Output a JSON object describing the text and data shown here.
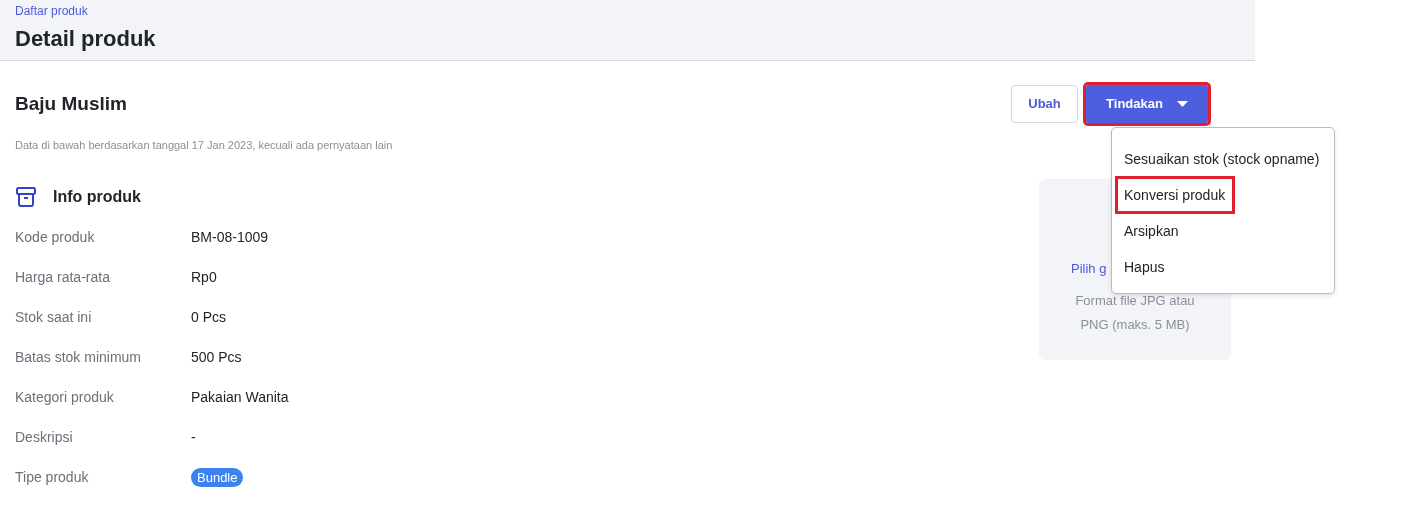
{
  "header": {
    "breadcrumb": "Daftar produk",
    "title": "Detail produk"
  },
  "product": {
    "name": "Baju Muslim",
    "note": "Data di bawah berdasarkan tanggal 17 Jan 2023, kecuali ada pernyataan lain"
  },
  "actions": {
    "edit_button": "Ubah",
    "menu_button": {
      "label": "Tindakan",
      "highlighted": true
    },
    "menu_items": [
      {
        "label": "Sesuaikan stok (stock opname)",
        "highlighted": false
      },
      {
        "label": "Konversi produk",
        "highlighted": true
      },
      {
        "label": "Arsipkan",
        "highlighted": false
      },
      {
        "label": "Hapus",
        "highlighted": false
      }
    ]
  },
  "info": {
    "title": "Info produk",
    "rows": [
      {
        "label": "Kode produk",
        "value": "BM-08-1009",
        "kind": "text"
      },
      {
        "label": "Harga rata-rata",
        "value": "Rp0",
        "kind": "text"
      },
      {
        "label": "Stok saat ini",
        "value": "0 Pcs",
        "kind": "text"
      },
      {
        "label": "Batas stok minimum",
        "value": "500 Pcs",
        "kind": "text"
      },
      {
        "label": "Kategori produk",
        "value": "Pakaian Wanita",
        "kind": "text"
      },
      {
        "label": "Deskripsi",
        "value": "-",
        "kind": "text"
      },
      {
        "label": "Tipe produk",
        "value": "Bundle",
        "kind": "badge"
      }
    ]
  },
  "image_upload": {
    "link": "Pilih g",
    "hint_lines": [
      "Format file JPG atau",
      "PNG (maks. 5 MB)"
    ]
  }
}
